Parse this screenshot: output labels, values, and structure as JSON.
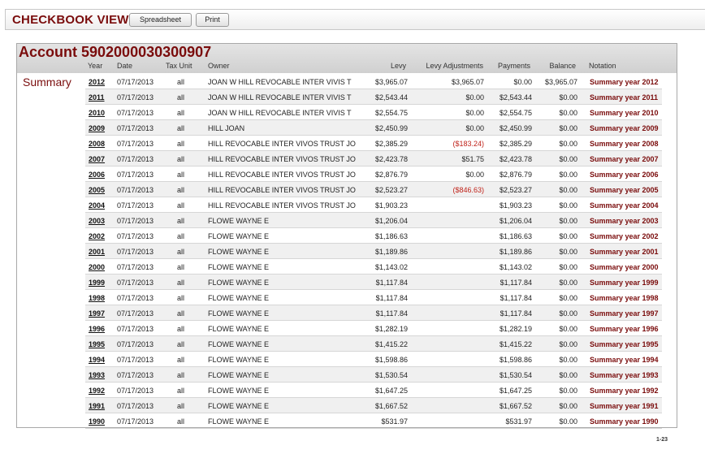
{
  "toolbar": {
    "title": "CHECKBOOK VIEW",
    "spreadsheet_label": "Spreadsheet",
    "print_label": "Print"
  },
  "account": {
    "title": "Account 5902000030300907",
    "summary_label": "Summary"
  },
  "columns": {
    "year": "Year",
    "date": "Date",
    "tax_unit": "Tax Unit",
    "owner": "Owner",
    "levy": "Levy",
    "levy_adjustments": "Levy Adjustments",
    "payments": "Payments",
    "balance": "Balance",
    "notation": "Notation"
  },
  "rows": [
    {
      "year": "2012",
      "date": "07/17/2013",
      "tax_unit": "all",
      "owner": "JOAN W HILL REVOCABLE INTER VIVIS T",
      "levy": "$3,965.07",
      "adj": "$3,965.07",
      "payments": "$0.00",
      "balance": "$3,965.07",
      "note": "Summary year 2012"
    },
    {
      "year": "2011",
      "date": "07/17/2013",
      "tax_unit": "all",
      "owner": "JOAN W HILL REVOCABLE INTER VIVIS T",
      "levy": "$2,543.44",
      "adj": "$0.00",
      "payments": "$2,543.44",
      "balance": "$0.00",
      "note": "Summary year 2011"
    },
    {
      "year": "2010",
      "date": "07/17/2013",
      "tax_unit": "all",
      "owner": "JOAN W HILL REVOCABLE INTER VIVIS T",
      "levy": "$2,554.75",
      "adj": "$0.00",
      "payments": "$2,554.75",
      "balance": "$0.00",
      "note": "Summary year 2010"
    },
    {
      "year": "2009",
      "date": "07/17/2013",
      "tax_unit": "all",
      "owner": "HILL JOAN",
      "levy": "$2,450.99",
      "adj": "$0.00",
      "payments": "$2,450.99",
      "balance": "$0.00",
      "note": "Summary year 2009"
    },
    {
      "year": "2008",
      "date": "07/17/2013",
      "tax_unit": "all",
      "owner": "HILL REVOCABLE INTER VIVOS TRUST JO",
      "levy": "$2,385.29",
      "adj": "($183.24)",
      "payments": "$2,385.29",
      "balance": "$0.00",
      "note": "Summary year 2008"
    },
    {
      "year": "2007",
      "date": "07/17/2013",
      "tax_unit": "all",
      "owner": "HILL REVOCABLE INTER VIVOS TRUST JO",
      "levy": "$2,423.78",
      "adj": "$51.75",
      "payments": "$2,423.78",
      "balance": "$0.00",
      "note": "Summary year 2007"
    },
    {
      "year": "2006",
      "date": "07/17/2013",
      "tax_unit": "all",
      "owner": "HILL REVOCABLE INTER VIVOS TRUST JO",
      "levy": "$2,876.79",
      "adj": "$0.00",
      "payments": "$2,876.79",
      "balance": "$0.00",
      "note": "Summary year 2006"
    },
    {
      "year": "2005",
      "date": "07/17/2013",
      "tax_unit": "all",
      "owner": "HILL REVOCABLE INTER VIVOS TRUST JO",
      "levy": "$2,523.27",
      "adj": "($846.63)",
      "payments": "$2,523.27",
      "balance": "$0.00",
      "note": "Summary year 2005"
    },
    {
      "year": "2004",
      "date": "07/17/2013",
      "tax_unit": "all",
      "owner": "HILL REVOCABLE INTER VIVOS TRUST JO",
      "levy": "$1,903.23",
      "adj": "",
      "payments": "$1,903.23",
      "balance": "$0.00",
      "note": "Summary year 2004"
    },
    {
      "year": "2003",
      "date": "07/17/2013",
      "tax_unit": "all",
      "owner": "FLOWE WAYNE E",
      "levy": "$1,206.04",
      "adj": "",
      "payments": "$1,206.04",
      "balance": "$0.00",
      "note": "Summary year 2003"
    },
    {
      "year": "2002",
      "date": "07/17/2013",
      "tax_unit": "all",
      "owner": "FLOWE WAYNE E",
      "levy": "$1,186.63",
      "adj": "",
      "payments": "$1,186.63",
      "balance": "$0.00",
      "note": "Summary year 2002"
    },
    {
      "year": "2001",
      "date": "07/17/2013",
      "tax_unit": "all",
      "owner": "FLOWE WAYNE E",
      "levy": "$1,189.86",
      "adj": "",
      "payments": "$1,189.86",
      "balance": "$0.00",
      "note": "Summary year 2001"
    },
    {
      "year": "2000",
      "date": "07/17/2013",
      "tax_unit": "all",
      "owner": "FLOWE WAYNE E",
      "levy": "$1,143.02",
      "adj": "",
      "payments": "$1,143.02",
      "balance": "$0.00",
      "note": "Summary year 2000"
    },
    {
      "year": "1999",
      "date": "07/17/2013",
      "tax_unit": "all",
      "owner": "FLOWE WAYNE E",
      "levy": "$1,117.84",
      "adj": "",
      "payments": "$1,117.84",
      "balance": "$0.00",
      "note": "Summary year 1999"
    },
    {
      "year": "1998",
      "date": "07/17/2013",
      "tax_unit": "all",
      "owner": "FLOWE WAYNE E",
      "levy": "$1,117.84",
      "adj": "",
      "payments": "$1,117.84",
      "balance": "$0.00",
      "note": "Summary year 1998"
    },
    {
      "year": "1997",
      "date": "07/17/2013",
      "tax_unit": "all",
      "owner": "FLOWE WAYNE E",
      "levy": "$1,117.84",
      "adj": "",
      "payments": "$1,117.84",
      "balance": "$0.00",
      "note": "Summary year 1997"
    },
    {
      "year": "1996",
      "date": "07/17/2013",
      "tax_unit": "all",
      "owner": "FLOWE WAYNE E",
      "levy": "$1,282.19",
      "adj": "",
      "payments": "$1,282.19",
      "balance": "$0.00",
      "note": "Summary year 1996"
    },
    {
      "year": "1995",
      "date": "07/17/2013",
      "tax_unit": "all",
      "owner": "FLOWE WAYNE E",
      "levy": "$1,415.22",
      "adj": "",
      "payments": "$1,415.22",
      "balance": "$0.00",
      "note": "Summary year 1995"
    },
    {
      "year": "1994",
      "date": "07/17/2013",
      "tax_unit": "all",
      "owner": "FLOWE WAYNE E",
      "levy": "$1,598.86",
      "adj": "",
      "payments": "$1,598.86",
      "balance": "$0.00",
      "note": "Summary year 1994"
    },
    {
      "year": "1993",
      "date": "07/17/2013",
      "tax_unit": "all",
      "owner": "FLOWE WAYNE E",
      "levy": "$1,530.54",
      "adj": "",
      "payments": "$1,530.54",
      "balance": "$0.00",
      "note": "Summary year 1993"
    },
    {
      "year": "1992",
      "date": "07/17/2013",
      "tax_unit": "all",
      "owner": "FLOWE WAYNE E",
      "levy": "$1,647.25",
      "adj": "",
      "payments": "$1,647.25",
      "balance": "$0.00",
      "note": "Summary year 1992"
    },
    {
      "year": "1991",
      "date": "07/17/2013",
      "tax_unit": "all",
      "owner": "FLOWE WAYNE E",
      "levy": "$1,667.52",
      "adj": "",
      "payments": "$1,667.52",
      "balance": "$0.00",
      "note": "Summary year 1991"
    },
    {
      "year": "1990",
      "date": "07/17/2013",
      "tax_unit": "all",
      "owner": "FLOWE WAYNE E",
      "levy": "$531.97",
      "adj": "",
      "payments": "$531.97",
      "balance": "$0.00",
      "note": "Summary year 1990"
    }
  ],
  "pager": "1-23",
  "colors": {
    "accent": "#7a0c0c",
    "negative": "#c0231a"
  }
}
